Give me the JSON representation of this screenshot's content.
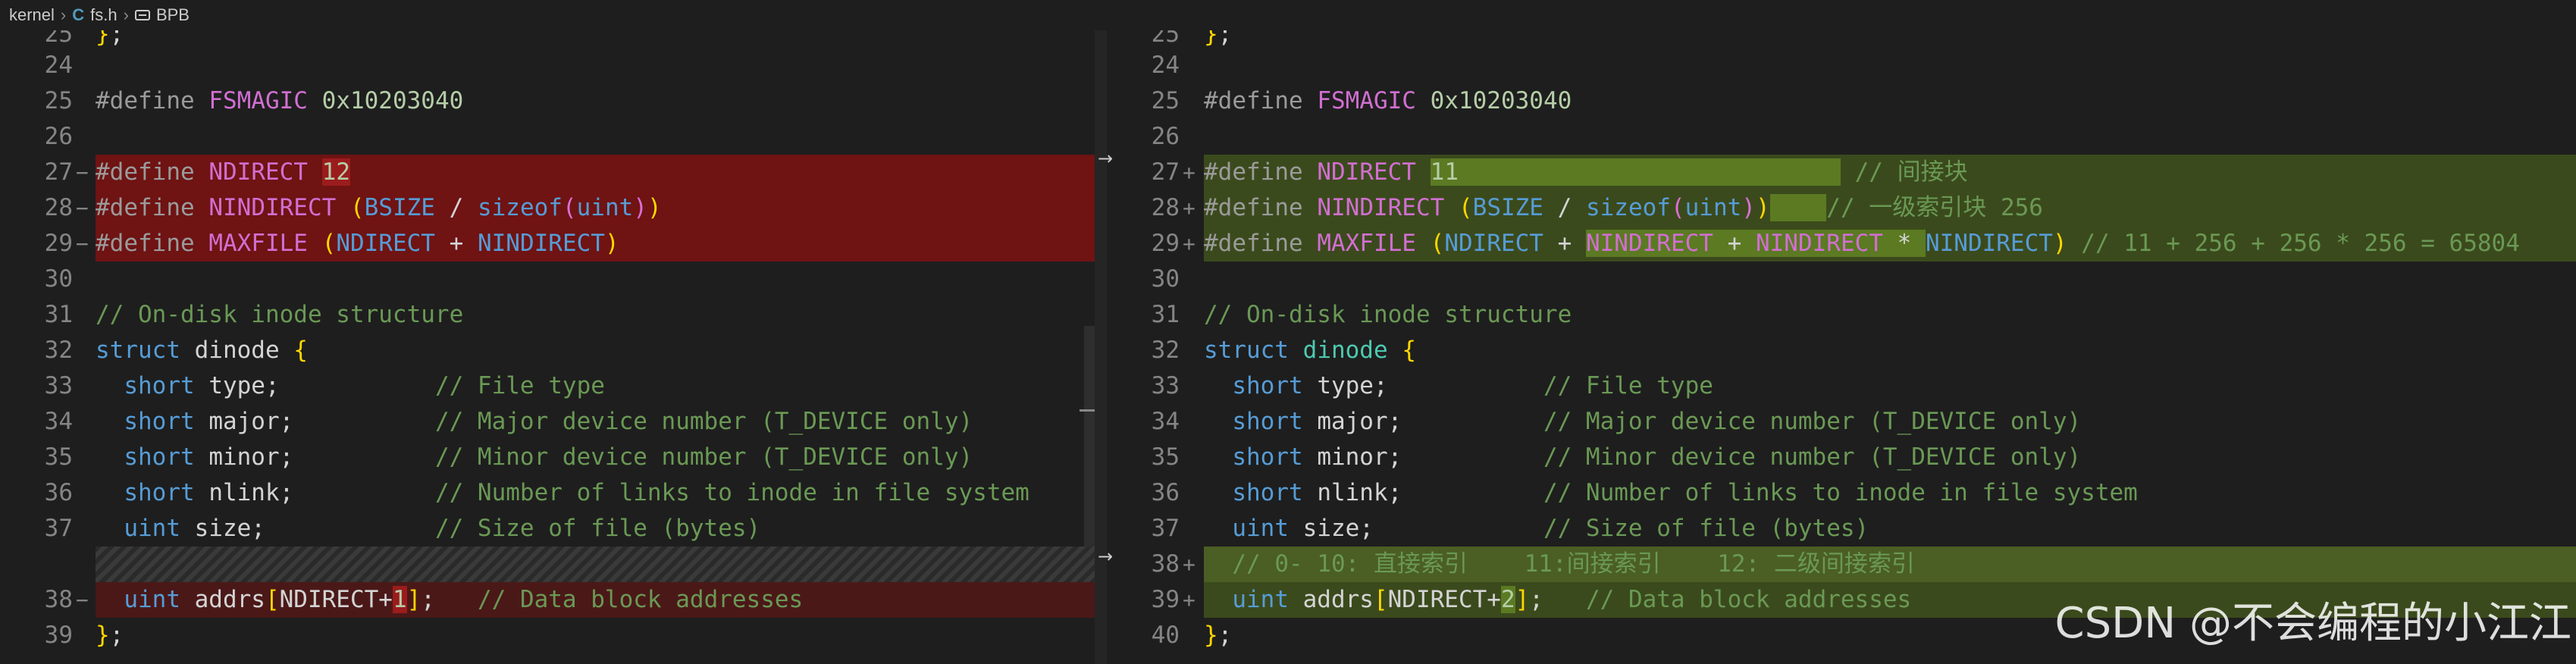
{
  "breadcrumb": {
    "folder": "kernel",
    "file": "fs.h",
    "file_icon": "C",
    "symbol": "BPB"
  },
  "left": {
    "lines": [
      {
        "num": "25",
        "mark": "",
        "text": "};"
      },
      {
        "num": "24",
        "mark": "",
        "text": ""
      },
      {
        "num": "25",
        "mark": "",
        "text": "#define FSMAGIC 0x10203040"
      },
      {
        "num": "26",
        "mark": "",
        "text": ""
      },
      {
        "num": "27",
        "mark": "−",
        "text": "#define NDIRECT 12"
      },
      {
        "num": "28",
        "mark": "−",
        "text": "#define NINDIRECT (BSIZE / sizeof(uint))"
      },
      {
        "num": "29",
        "mark": "−",
        "text": "#define MAXFILE (NDIRECT + NINDIRECT)"
      },
      {
        "num": "30",
        "mark": "",
        "text": ""
      },
      {
        "num": "31",
        "mark": "",
        "text": "// On-disk inode structure"
      },
      {
        "num": "32",
        "mark": "",
        "text": "struct dinode {"
      },
      {
        "num": "33",
        "mark": "",
        "text": "  short type;           // File type"
      },
      {
        "num": "34",
        "mark": "",
        "text": "  short major;          // Major device number (T_DEVICE only)"
      },
      {
        "num": "35",
        "mark": "",
        "text": "  short minor;          // Minor device number (T_DEVICE only)"
      },
      {
        "num": "36",
        "mark": "",
        "text": "  short nlink;          // Number of links to inode in file system"
      },
      {
        "num": "37",
        "mark": "",
        "text": "  uint size;            // Size of file (bytes)"
      },
      {
        "num": "",
        "mark": "",
        "text": ""
      },
      {
        "num": "38",
        "mark": "−",
        "text": "  uint addrs[NDIRECT+1];   // Data block addresses"
      },
      {
        "num": "39",
        "mark": "",
        "text": "};"
      }
    ]
  },
  "right": {
    "lines": [
      {
        "num": "25",
        "mark": "",
        "text": "};"
      },
      {
        "num": "24",
        "mark": "",
        "text": ""
      },
      {
        "num": "25",
        "mark": "",
        "text": "#define FSMAGIC 0x10203040"
      },
      {
        "num": "26",
        "mark": "",
        "text": ""
      },
      {
        "num": "27",
        "mark": "+",
        "text": "#define NDIRECT 11                           // 间接块"
      },
      {
        "num": "28",
        "mark": "+",
        "text": "#define NINDIRECT (BSIZE / sizeof(uint))    // 一级索引块 256"
      },
      {
        "num": "29",
        "mark": "+",
        "text": "#define MAXFILE (NDIRECT + NINDIRECT + NINDIRECT * NINDIRECT) // 11 + 256 + 256 * 256 = 65804"
      },
      {
        "num": "30",
        "mark": "",
        "text": ""
      },
      {
        "num": "31",
        "mark": "",
        "text": "// On-disk inode structure"
      },
      {
        "num": "32",
        "mark": "",
        "text": "struct dinode {"
      },
      {
        "num": "33",
        "mark": "",
        "text": "  short type;           // File type"
      },
      {
        "num": "34",
        "mark": "",
        "text": "  short major;          // Major device number (T_DEVICE only)"
      },
      {
        "num": "35",
        "mark": "",
        "text": "  short minor;          // Minor device number (T_DEVICE only)"
      },
      {
        "num": "36",
        "mark": "",
        "text": "  short nlink;          // Number of links to inode in file system"
      },
      {
        "num": "37",
        "mark": "",
        "text": "  uint size;            // Size of file (bytes)"
      },
      {
        "num": "38",
        "mark": "+",
        "text": "  // 0- 10: 直接索引    11:间接索引    12: 二级间接索引"
      },
      {
        "num": "39",
        "mark": "+",
        "text": "  uint addrs[NDIRECT+2];   // Data block addresses"
      },
      {
        "num": "40",
        "mark": "",
        "text": "};"
      }
    ]
  },
  "watermark": "CSDN @不会编程的小江江",
  "colors": {
    "editor_bg": "#1e1e1e",
    "deleted_bg": "#6f1313",
    "inserted_bg": "#4b5e23",
    "comment": "#6a9955",
    "macro": "#c586c0",
    "number": "#b5cea8",
    "type": "#4ec9b0"
  },
  "icons": {
    "file_icon": "c-language-icon",
    "symbol_icon": "struct-symbol-icon",
    "revert_arrow": "arrow-right-icon"
  }
}
